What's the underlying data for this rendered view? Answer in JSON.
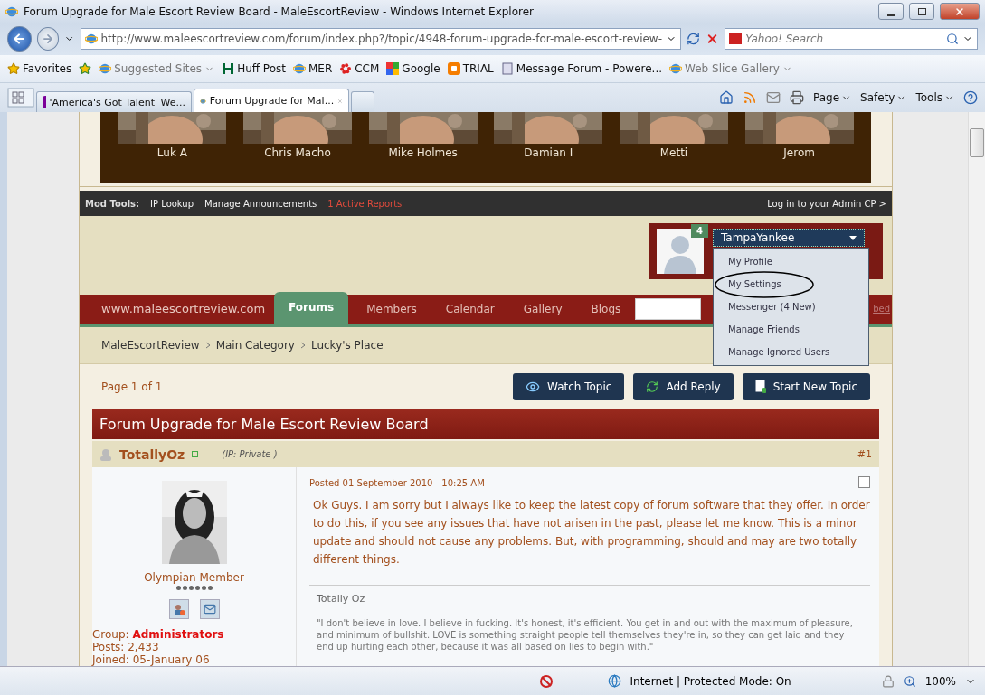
{
  "window": {
    "title": "Forum Upgrade for Male Escort Review Board - MaleEscortReview - Windows Internet Explorer"
  },
  "address_bar": {
    "url": "http://www.maleescortreview.com/forum/index.php?/topic/4948-forum-upgrade-for-male-escort-review-",
    "search_placeholder": "Yahoo! Search"
  },
  "favorites_bar": {
    "label": "Favorites",
    "items": [
      {
        "label": "Suggested Sites",
        "dropdown": true
      },
      {
        "label": "Huff Post",
        "dropdown": false
      },
      {
        "label": "MER",
        "dropdown": false
      },
      {
        "label": "CCM",
        "dropdown": false
      },
      {
        "label": "Google",
        "dropdown": false
      },
      {
        "label": "TRIAL",
        "dropdown": false
      },
      {
        "label": "Message Forum - Powere...",
        "dropdown": false
      },
      {
        "label": "Web Slice Gallery",
        "dropdown": true
      }
    ]
  },
  "tabs": [
    {
      "label": "'America's Got Talent' We...",
      "selected": false
    },
    {
      "label": "Forum Upgrade for Mal...",
      "selected": true
    }
  ],
  "command_bar": [
    "Page",
    "Safety",
    "Tools"
  ],
  "gallery": [
    {
      "name": "Luk A"
    },
    {
      "name": "Chris Macho"
    },
    {
      "name": "Mike Holmes"
    },
    {
      "name": "Damian I"
    },
    {
      "name": "Metti"
    },
    {
      "name": "Jerom"
    }
  ],
  "mod_tools": {
    "label": "Mod Tools:",
    "links": [
      "IP Lookup",
      "Manage Announcements"
    ],
    "reports": "1 Active Reports",
    "admin_link": "Log in to your Admin CP >"
  },
  "user_menu": {
    "notifications": "4",
    "username": "TampaYankee",
    "expanded": true,
    "items": [
      {
        "label": "My Profile",
        "circled": false
      },
      {
        "label": "My Settings",
        "circled": true
      },
      {
        "label": "Messenger (4 New)",
        "circled": false
      },
      {
        "label": "Manage Friends",
        "circled": false
      },
      {
        "label": "Manage Ignored Users",
        "circled": false
      }
    ]
  },
  "nav": {
    "site": "www.maleescortreview.com",
    "items": [
      {
        "label": "Forums",
        "selected": true
      },
      {
        "label": "Members",
        "selected": false
      },
      {
        "label": "Calendar",
        "selected": false
      },
      {
        "label": "Gallery",
        "selected": false
      },
      {
        "label": "Blogs",
        "selected": false
      }
    ],
    "partial_link": "bed"
  },
  "breadcrumbs": [
    "MaleEscortReview",
    "Main Category",
    "Lucky's Place"
  ],
  "pagination": "Page 1 of 1",
  "actions": [
    "Watch Topic",
    "Add Reply",
    "Start New Topic"
  ],
  "topic": {
    "title": "Forum Upgrade for Male Escort Review Board"
  },
  "post": {
    "author": "TotallyOz",
    "ip": "(IP: Private )",
    "number": "#1",
    "date": "Posted 01 September 2010 - 10:25 AM",
    "checked": false,
    "body": "Ok Guys. I am sorry but I always like to keep the latest copy of forum software that they offer. In order to do this, if you see any issues that have not arisen in the past, please let me know. This is a minor update and should not cause any problems. But, with programming, should and may are two totally different things.",
    "rank": "Olympian Member",
    "stars": 6,
    "group_label": "Group:",
    "group": "Administrators",
    "posts": "Posts: 2,433",
    "joined": "Joined: 05-January 06",
    "signature_name": "Totally Oz",
    "signature_quote": "\"I don't believe in love. I believe in fucking. It's honest, it's efficient. You get in and out with the maximum of pleasure, and minimum of bullshit. LOVE is something straight people tell themselves they're in, so they can get laid and they end up hurting each other, because it was all based on lies to begin with.\""
  },
  "status_bar": {
    "zone": "Internet | Protected Mode: On",
    "zoom": "100%"
  }
}
